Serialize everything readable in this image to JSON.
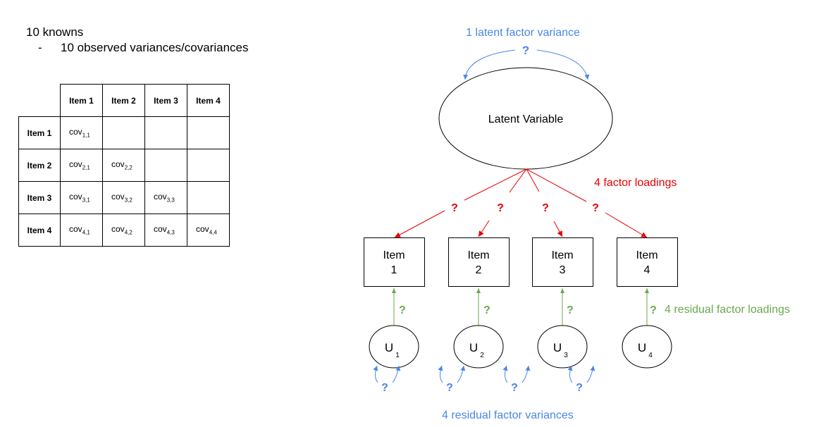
{
  "knowns": {
    "title": "10 knowns",
    "bullet_dash": "-",
    "bullet": "10 observed variances/covariances"
  },
  "table": {
    "col_headers": [
      "Item 1",
      "Item 2",
      "Item 3",
      "Item 4"
    ],
    "rows": [
      {
        "label": "Item 1",
        "cells": [
          {
            "base": "cov",
            "sub": "1,1"
          },
          null,
          null,
          null
        ]
      },
      {
        "label": "Item 2",
        "cells": [
          {
            "base": "cov",
            "sub": "2,1"
          },
          {
            "base": "cov",
            "sub": "2,2"
          },
          null,
          null
        ]
      },
      {
        "label": "Item 3",
        "cells": [
          {
            "base": "cov",
            "sub": "3,1"
          },
          {
            "base": "cov",
            "sub": "3,2"
          },
          {
            "base": "cov",
            "sub": "3,3"
          },
          null
        ]
      },
      {
        "label": "Item 4",
        "cells": [
          {
            "base": "cov",
            "sub": "4,1"
          },
          {
            "base": "cov",
            "sub": "4,2"
          },
          {
            "base": "cov",
            "sub": "4,3"
          },
          {
            "base": "cov",
            "sub": "4,4"
          }
        ]
      }
    ]
  },
  "diagram": {
    "latent_variance_label": "1 latent factor variance",
    "latent_label": "Latent Variable",
    "unknown_mark": "?",
    "factor_loadings_label": "4 factor loadings",
    "residual_loadings_label": "4 residual factor loadings",
    "residual_variances_label": "4 residual factor variances",
    "items": [
      {
        "line1": "Item",
        "line2": "1"
      },
      {
        "line1": "Item",
        "line2": "2"
      },
      {
        "line1": "Item",
        "line2": "3"
      },
      {
        "line1": "Item",
        "line2": "4"
      }
    ],
    "residuals": [
      {
        "base": "U",
        "sub": "1"
      },
      {
        "base": "U",
        "sub": "2"
      },
      {
        "base": "U",
        "sub": "3"
      },
      {
        "base": "U",
        "sub": "4"
      }
    ],
    "colors": {
      "variance": "#4a86e8",
      "loading": "#ea0000",
      "residual_loading": "#6aa84f",
      "outline": "#000000"
    }
  }
}
